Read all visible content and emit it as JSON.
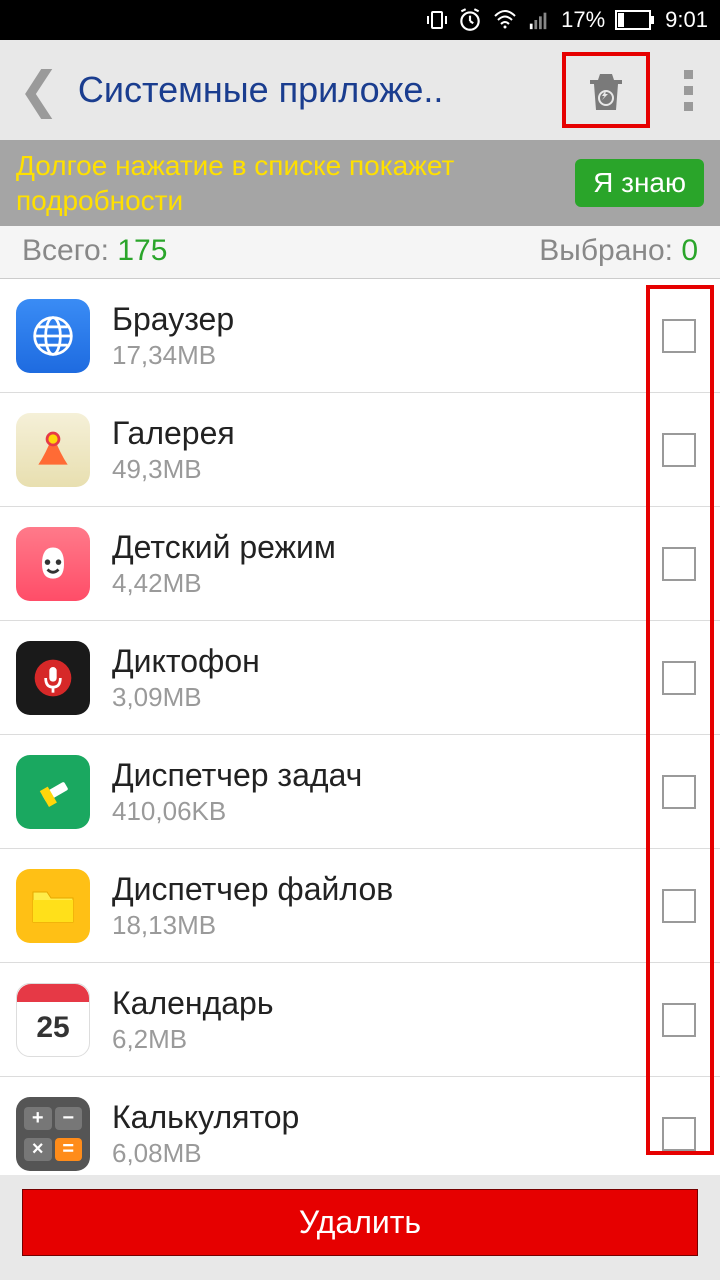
{
  "status": {
    "battery": "17%",
    "time": "9:01"
  },
  "header": {
    "title": "Системные приложе.."
  },
  "hint": {
    "text": "Долгое нажатие в списке покажет подробности",
    "button": "Я знаю"
  },
  "stats": {
    "total_label": "Всего: ",
    "total_value": "175",
    "selected_label": "Выбрано: ",
    "selected_value": "0"
  },
  "apps": [
    {
      "name": "Браузер",
      "size": "17,34MB"
    },
    {
      "name": "Галерея",
      "size": "49,3MB"
    },
    {
      "name": "Детский режим",
      "size": "4,42MB"
    },
    {
      "name": "Диктофон",
      "size": "3,09MB"
    },
    {
      "name": "Диспетчер задач",
      "size": "410,06KB"
    },
    {
      "name": "Диспетчер файлов",
      "size": "18,13MB"
    },
    {
      "name": "Календарь",
      "size": "6,2MB"
    },
    {
      "name": "Калькулятор",
      "size": "6,08MB"
    }
  ],
  "footer": {
    "delete": "Удалить"
  }
}
